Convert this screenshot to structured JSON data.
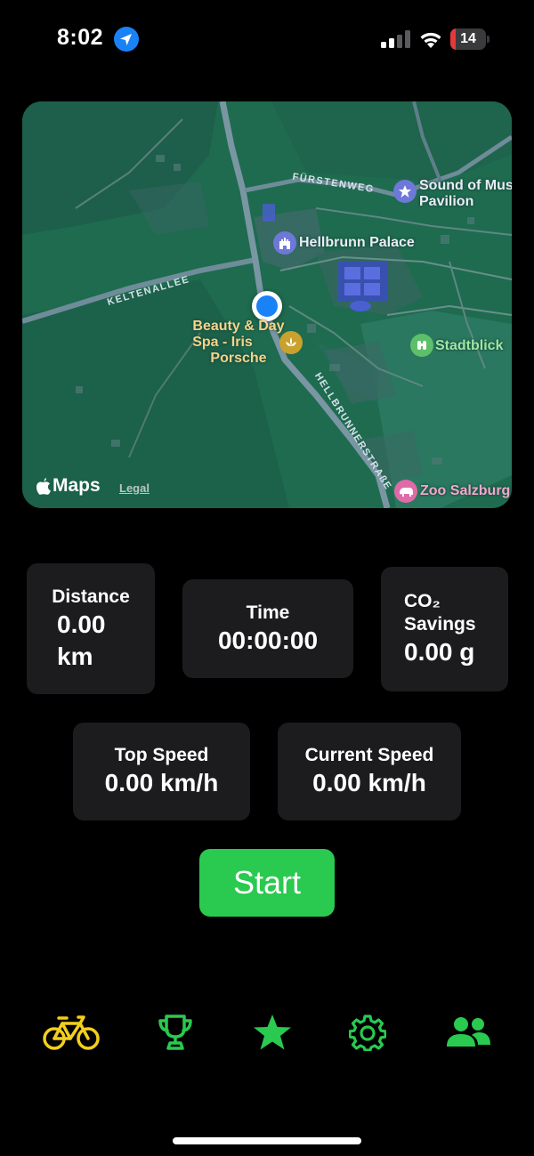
{
  "status_bar": {
    "time": "8:02",
    "battery_level": "14",
    "battery_fraction": 0.14
  },
  "map": {
    "labels": {
      "palace": "Hellbrunn Palace",
      "pavilion_line1": "Sound of Mus",
      "pavilion_line2": "Pavilion",
      "stadtblick": "Stadtblick",
      "zoo": "Zoo Salzburg",
      "spa_line1": "Beauty & Day",
      "spa_line2": "Spa - Iris",
      "spa_line3": "Porsche"
    },
    "streets": {
      "fuerstenweg": "FÜRSTENWEG",
      "keltenallee": "KELTENALLEE",
      "hellbrunnerstrasse": "HELLBRUNNERSTRAßE"
    },
    "brand": "Maps",
    "legal": "Legal"
  },
  "stats": {
    "distance": {
      "title": "Distance",
      "value_line1": "0.00",
      "value_line2": "km"
    },
    "time": {
      "title": "Time",
      "value": "00:00:00"
    },
    "co2": {
      "title_line1": "CO₂",
      "title_line2": "Savings",
      "value": "0.00 g"
    },
    "top_speed": {
      "title": "Top Speed",
      "value": "0.00 km/h"
    },
    "current_speed": {
      "title": "Current Speed",
      "value": "0.00 km/h"
    }
  },
  "start_label": "Start",
  "tabs": [
    {
      "icon": "bicycle-icon",
      "color": "#f2cf1d",
      "active": true
    },
    {
      "icon": "trophy-icon",
      "color": "#2ac94f"
    },
    {
      "icon": "star-icon",
      "color": "#2ac94f"
    },
    {
      "icon": "gear-icon",
      "color": "#2ac94f"
    },
    {
      "icon": "people-icon",
      "color": "#2ac94f"
    }
  ],
  "colors": {
    "accent_green": "#2ac94f",
    "active_tab": "#f2cf1d",
    "card_bg": "#1c1c1e",
    "user_location": "#1a82f7"
  }
}
